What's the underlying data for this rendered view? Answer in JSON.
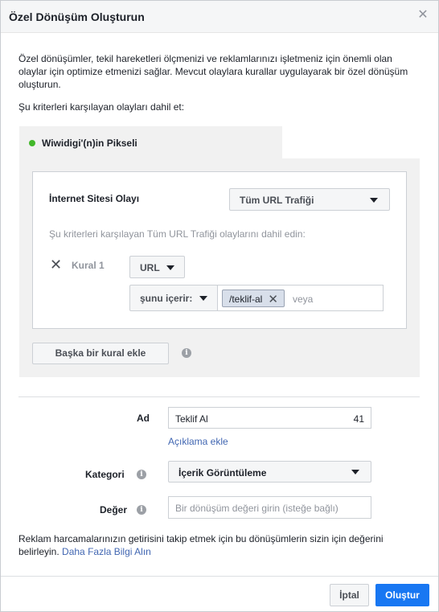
{
  "dialog": {
    "title": "Özel Dönüşüm Oluşturun",
    "close_icon": "close-icon"
  },
  "intro": {
    "text": "Özel dönüşümler, tekil hareketleri ölçmenizi ve reklamlarınızı işletmeniz için önemli olan olaylar için optimize etmenizi sağlar. Mevcut olaylara kurallar uygulayarak bir özel dönüşüm oluşturun.",
    "criteria_label": "Şu kriterleri karşılayan olayları dahil et:"
  },
  "pixel": {
    "name": "Wiwidigi'(n)in Pikseli",
    "status_color": "#42b72a"
  },
  "rules": {
    "event_label": "İnternet Sitesi Olayı",
    "event_value": "Tüm URL Trafiği",
    "hint": "Şu kriterleri karşılayan Tüm URL Trafiği olaylarını dahil edin:",
    "rule_label": "Kural 1",
    "field_value": "URL",
    "operator_value": "şunu içerir:",
    "tokens": [
      "/teklif-al"
    ],
    "token_placeholder": "veya",
    "add_rule_label": "Başka bir kural ekle"
  },
  "form": {
    "name_label": "Ad",
    "name_value": "Teklif Al",
    "name_remaining": "41",
    "add_description": "Açıklama ekle",
    "category_label": "Kategori",
    "category_value": "İçerik Görüntüleme",
    "value_label": "Değer",
    "value_placeholder": "Bir dönüşüm değeri girin (isteğe bağlı)"
  },
  "footer": {
    "note": "Reklam harcamalarınızın getirisini takip etmek için bu dönüşümlerin sizin için değerini belirleyin.",
    "learn_more": "Daha Fazla Bilgi Alın",
    "cancel_label": "İptal",
    "create_label": "Oluştur",
    "primary_color": "#1877f2"
  }
}
